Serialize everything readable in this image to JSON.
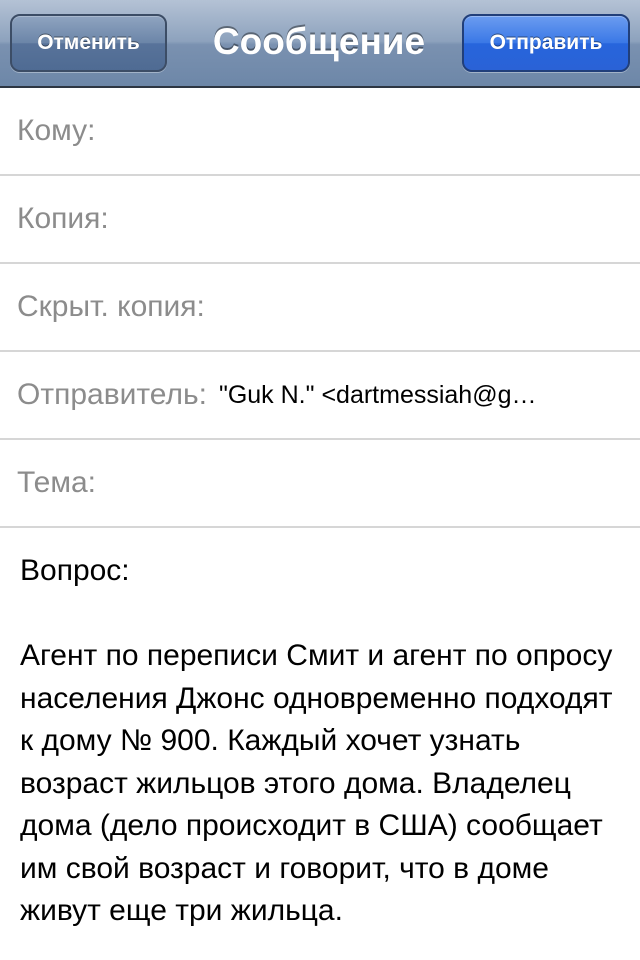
{
  "navbar": {
    "cancel_label": "Отменить",
    "title": "Сообщение",
    "send_label": "Отправить"
  },
  "fields": {
    "to_label": "Кому:",
    "cc_label": "Копия:",
    "bcc_label": "Скрыт. копия:",
    "from_label": "Отправитель:",
    "from_value": "\"Guk N.\" <dartmessiah@g…",
    "subject_label": "Тема:"
  },
  "body": {
    "heading": "Вопрос:",
    "paragraph": "Агент по переписи Смит и агент по опросу населения Джонс одновременно подходят к дому № 900. Каждый хочет узнать возраст жильцов этого дома. Владелец дома (дело происходит в США) сообщает им свой возраст и говорит, что в доме живут еще три жильца."
  }
}
